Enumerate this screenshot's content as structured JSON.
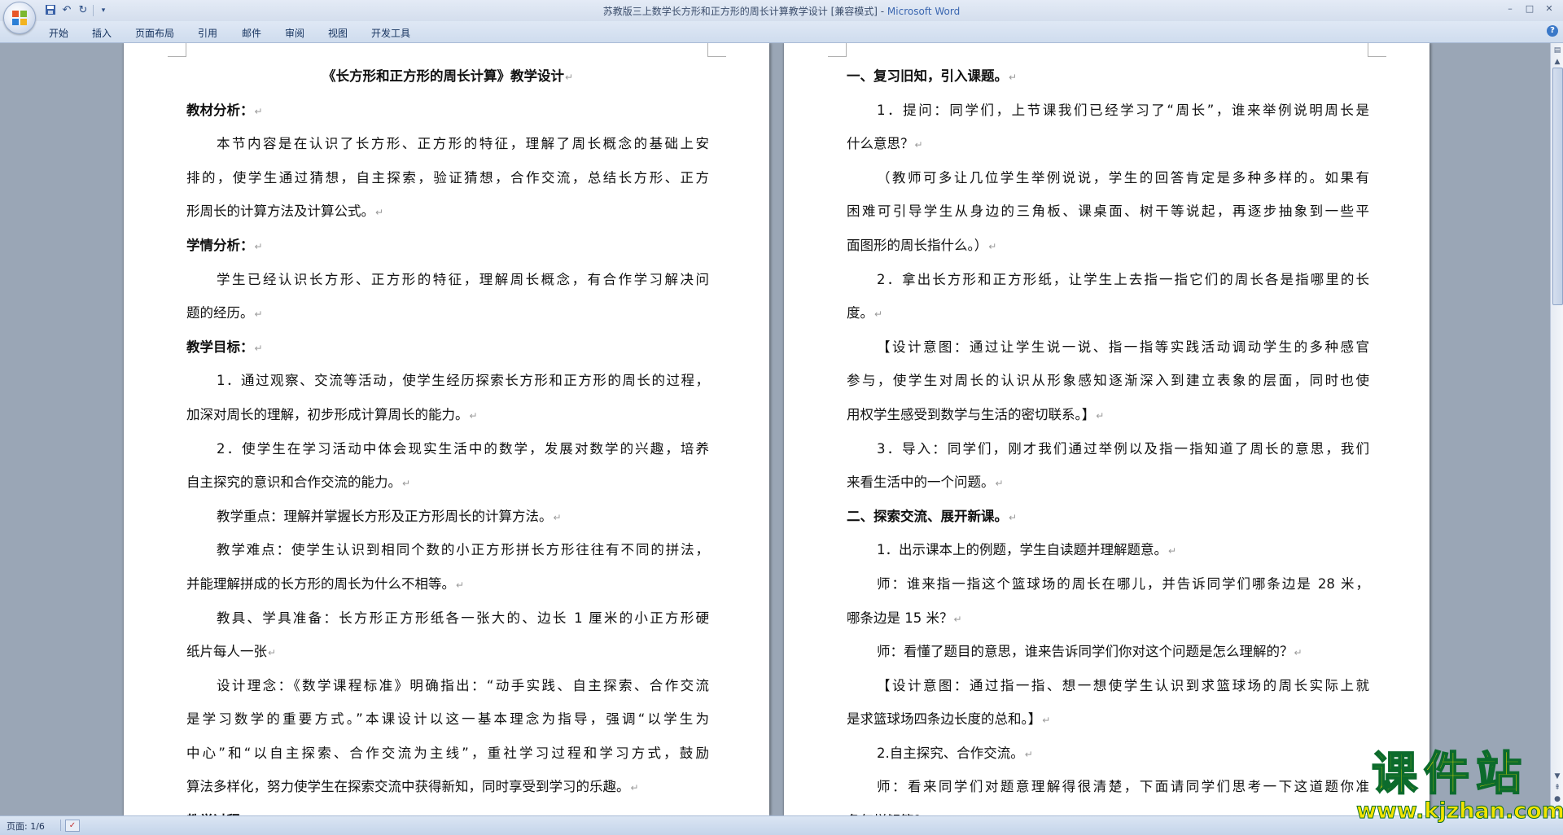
{
  "window": {
    "title": "苏教版三上数学长方形和正方形的周长计算教学设计 [兼容模式] - ",
    "app_name": "Microsoft Word"
  },
  "qat": {
    "save_icon": "save-icon",
    "undo_icon": "undo-icon",
    "redo_icon": "redo-icon",
    "customize_icon": "chevron-down-icon"
  },
  "ribbon": {
    "tabs": [
      "开始",
      "插入",
      "页面布局",
      "引用",
      "邮件",
      "审阅",
      "视图",
      "开发工具"
    ]
  },
  "document": {
    "paragraph_mark": "↵",
    "left_page": [
      {
        "text": "《长方形和正方形的周长计算》教学设计",
        "style": "center bold"
      },
      {
        "text": "教材分析：",
        "style": "bold"
      },
      {
        "text": "本节内容是在认识了长方形、正方形的特征，理解了周长概念的基础上安",
        "style": "indent justify",
        "nomark": true
      },
      {
        "text": "排的，使学生通过猜想，自主探索，验证猜想，合作交流，总结长方形、正方",
        "style": "justify",
        "nomark": true
      },
      {
        "text": "形周长的计算方法及计算公式。",
        "style": ""
      },
      {
        "text": "学情分析：",
        "style": "bold"
      },
      {
        "text": "学生已经认识长方形、正方形的特征，理解周长概念，有合作学习解决问",
        "style": "indent justify",
        "nomark": true
      },
      {
        "text": "题的经历。",
        "style": ""
      },
      {
        "text": "教学目标：",
        "style": "bold"
      },
      {
        "text": "1．通过观察、交流等活动，使学生经历探索长方形和正方形的周长的过程，",
        "style": "indent justify",
        "nomark": true
      },
      {
        "text": "加深对周长的理解，初步形成计算周长的能力。",
        "style": ""
      },
      {
        "text": "2．使学生在学习活动中体会现实生活中的数学，发展对数学的兴趣，培养",
        "style": "indent justify",
        "nomark": true
      },
      {
        "text": "自主探究的意识和合作交流的能力。",
        "style": ""
      },
      {
        "text": "教学重点：理解并掌握长方形及正方形周长的计算方法。",
        "style": "indent"
      },
      {
        "text": "教学难点：使学生认识到相同个数的小正方形拼长方形往往有不同的拼法，",
        "style": "indent justify",
        "nomark": true
      },
      {
        "text": "并能理解拼成的长方形的周长为什么不相等。",
        "style": ""
      },
      {
        "text": "教具、学具准备：长方形正方形纸各一张大的、边长 1 厘米的小正方形硬",
        "style": "indent justify",
        "nomark": true
      },
      {
        "text": "纸片每人一张",
        "style": ""
      },
      {
        "text": "设计理念：《数学课程标准》明确指出：“动手实践、自主探索、合作交流",
        "style": "indent justify",
        "nomark": true
      },
      {
        "text": "是学习数学的重要方式。”本课设计以这一基本理念为指导，强调“以学生为",
        "style": "justify",
        "nomark": true
      },
      {
        "text": "中心”和“以自主探索、合作交流为主线”，重社学习过程和学习方式，鼓励",
        "style": "justify",
        "nomark": true
      },
      {
        "text": "算法多样化，努力使学生在探索交流中获得新知，同时享受到学习的乐趣。",
        "style": ""
      },
      {
        "text": "教学过程：",
        "style": "bold"
      }
    ],
    "right_page": [
      {
        "text": "一、复习旧知，引入课题。",
        "style": "bold"
      },
      {
        "text": "1．提问：同学们，上节课我们已经学习了“周长”，谁来举例说明周长是",
        "style": "indent justify",
        "nomark": true
      },
      {
        "text": "什么意思？",
        "style": ""
      },
      {
        "text": "（教师可多让几位学生举例说说，学生的回答肯定是多种多样的。如果有",
        "style": "indent justify",
        "nomark": true
      },
      {
        "text": "困难可引导学生从身边的三角板、课桌面、树干等说起，再逐步抽象到一些平",
        "style": "justify",
        "nomark": true
      },
      {
        "text": "面图形的周长指什么。）",
        "style": ""
      },
      {
        "text": "2．拿出长方形和正方形纸，让学生上去指一指它们的周长各是指哪里的长",
        "style": "indent justify",
        "nomark": true
      },
      {
        "text": "度。",
        "style": ""
      },
      {
        "text": "【设计意图：通过让学生说一说、指一指等实践活动调动学生的多种感官",
        "style": "indent justify",
        "nomark": true
      },
      {
        "text": "参与，使学生对周长的认识从形象感知逐渐深入到建立表象的层面，同时也使",
        "style": "justify",
        "nomark": true
      },
      {
        "text": "用权学生感受到数学与生活的密切联系。】",
        "style": ""
      },
      {
        "text": "3．导入：同学们，刚才我们通过举例以及指一指知道了周长的意思，我们",
        "style": "indent justify",
        "nomark": true
      },
      {
        "text": "来看生活中的一个问题。",
        "style": ""
      },
      {
        "text": "二、探索交流、展开新课。",
        "style": "bold"
      },
      {
        "text": "1．出示课本上的例题，学生自读题并理解题意。",
        "style": "indent"
      },
      {
        "text": "师：谁来指一指这个篮球场的周长在哪儿，并告诉同学们哪条边是 28 米，",
        "style": "indent justify",
        "nomark": true
      },
      {
        "text": "哪条边是 15 米？",
        "style": ""
      },
      {
        "text": "师：看懂了题目的意思，谁来告诉同学们你对这个问题是怎么理解的？",
        "style": "indent"
      },
      {
        "text": "【设计意图：通过指一指、想一想使学生认识到求篮球场的周长实际上就",
        "style": "indent justify",
        "nomark": true
      },
      {
        "text": "是求篮球场四条边长度的总和。】",
        "style": ""
      },
      {
        "text": "2.自主探究、合作交流。",
        "style": "indent"
      },
      {
        "text": "师：看来同学们对题意理解得很清楚，下面请同学们思考一下这道题你准",
        "style": "indent justify",
        "nomark": true
      },
      {
        "text": "备怎样解答？",
        "style": ""
      }
    ]
  },
  "statusbar": {
    "page_label": "页面: 1/6",
    "proofing_icon": "proofing-icon"
  },
  "watermark": {
    "text": "课件站",
    "url": "www.kjzhan.com"
  }
}
